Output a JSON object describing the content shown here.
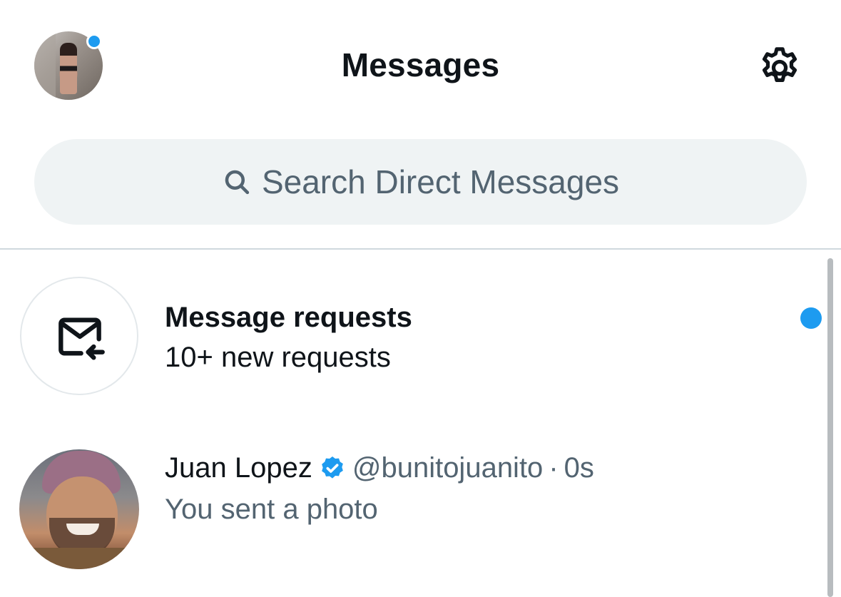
{
  "header": {
    "title": "Messages",
    "has_notification_dot": true,
    "icons": {
      "settings": "gear-icon"
    }
  },
  "search": {
    "placeholder": "Search Direct Messages",
    "icon": "search-icon"
  },
  "requests": {
    "title": "Message requests",
    "subtitle": "10+ new requests",
    "unread": true,
    "icon": "message-request-icon"
  },
  "conversations": [
    {
      "name": "Juan Lopez",
      "verified": true,
      "handle": "@bunitojuanito",
      "separator": "·",
      "time": "0s",
      "preview": "You sent a photo"
    }
  ],
  "colors": {
    "accent": "#1d9bf0",
    "text_primary": "#0f1419",
    "text_secondary": "#536471",
    "search_bg": "#eff3f4",
    "divider": "#cfd9de"
  }
}
